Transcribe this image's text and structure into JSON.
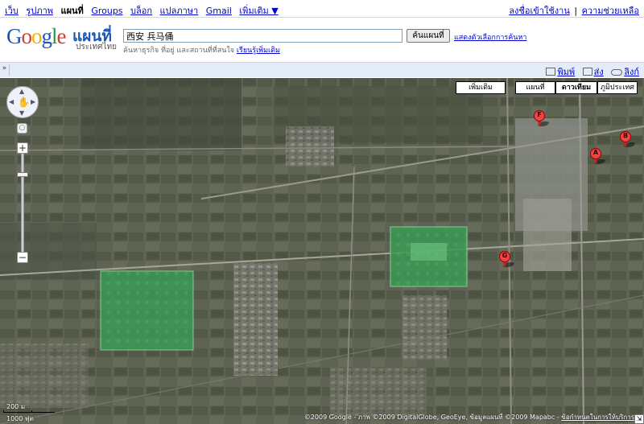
{
  "topnav": {
    "links": [
      {
        "label": "เว็บ",
        "current": false
      },
      {
        "label": "รูปภาพ",
        "current": false
      },
      {
        "label": "แผนที่",
        "current": true
      },
      {
        "label": "Groups",
        "current": false
      },
      {
        "label": "บล็อก",
        "current": false
      },
      {
        "label": "แปลภาษา",
        "current": false
      },
      {
        "label": "Gmail",
        "current": false
      },
      {
        "label": "เพิ่มเติม ▼",
        "current": false
      }
    ],
    "signin": "ลงชื่อเข้าใช้งาน",
    "help": "ความช่วยเหลือ",
    "separator": "|"
  },
  "header": {
    "logo_text": "Google",
    "product": "แผนที่",
    "country": "ประเทศไทย",
    "search_value": "西安 兵马俑",
    "search_button": "ค้นแผนที่",
    "search_options": "แสดงตัวเลือกการค้นหา",
    "hint": "ค้นหาธุรกิจ ที่อยู่ และสถานที่ที่สนใจ",
    "hint_link": "เรียนรู้เพิ่มเติม"
  },
  "toolbar": {
    "collapse": "»",
    "tools": [
      {
        "icon": "print-icon",
        "label": "พิมพ์"
      },
      {
        "icon": "email-icon",
        "label": "ส่ง"
      },
      {
        "icon": "link-icon",
        "label": "ลิงก์"
      }
    ]
  },
  "map": {
    "type_buttons": [
      {
        "label": "เพิ่มเติม",
        "selected": false
      },
      {
        "label": "แผนที่",
        "selected": false
      },
      {
        "label": "ดาวเทียม",
        "selected": true
      },
      {
        "label": "ภูมิประเทศ",
        "selected": false
      }
    ],
    "zoom_in": "+",
    "zoom_out": "−",
    "markers": [
      "F",
      "B",
      "A",
      "G"
    ],
    "scale": {
      "metric": "200 ม",
      "imperial": "1000 ฟุต"
    },
    "copyright": "©2009 Google - ภาพ ©2009 DigitalGlobe, GeoEye, ข้อมูลแผนที่ ©2009 Mapabc - ",
    "terms_link": "ข้อกำหนดในการให้บริการ",
    "colors": {
      "highlight_green": "#3fa85a",
      "marker_red": "#e44444",
      "imagery_base": "#5d6050"
    }
  }
}
